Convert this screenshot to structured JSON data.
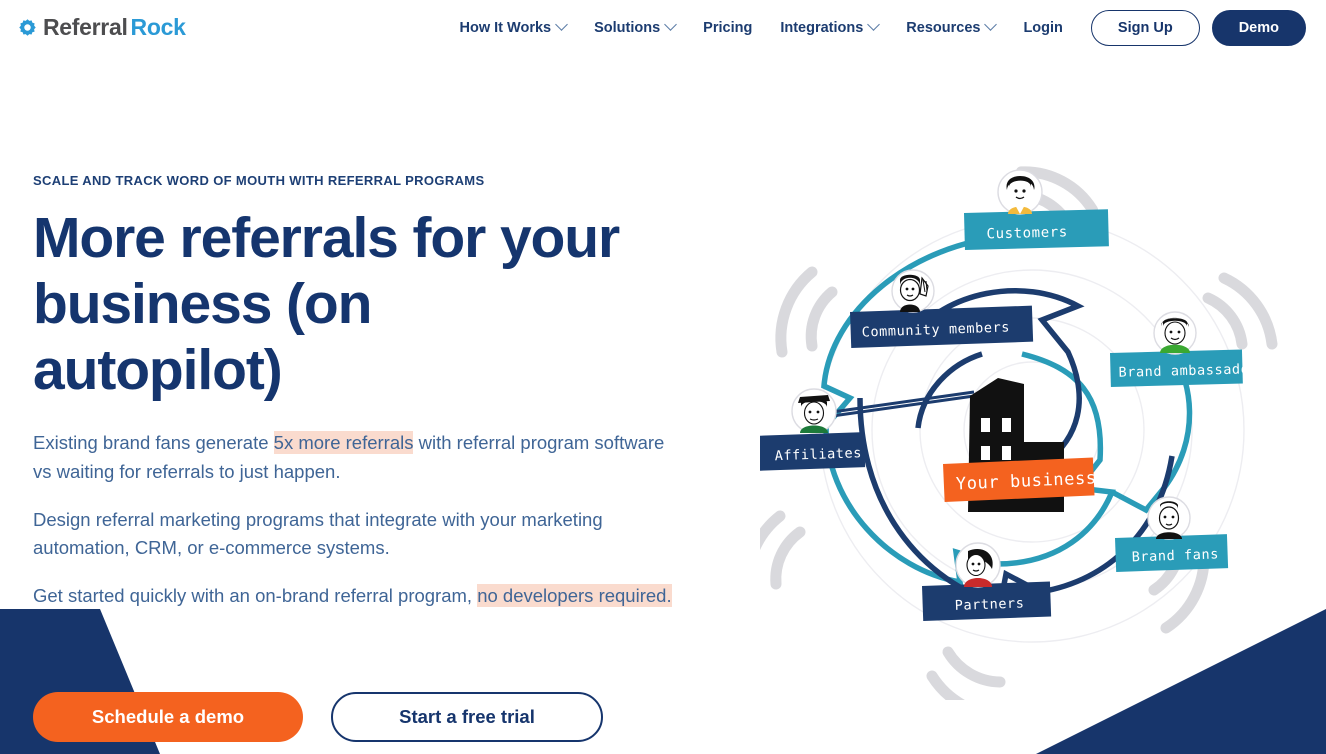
{
  "brand": {
    "icon": "gear-icon",
    "name_part1": "Referral",
    "name_part2": "Rock",
    "icon_color": "#2b9ad6"
  },
  "nav": {
    "items": [
      {
        "label": "How It Works",
        "has_dropdown": true
      },
      {
        "label": "Solutions",
        "has_dropdown": true
      },
      {
        "label": "Pricing",
        "has_dropdown": false
      },
      {
        "label": "Integrations",
        "has_dropdown": true
      },
      {
        "label": "Resources",
        "has_dropdown": true
      },
      {
        "label": "Login",
        "has_dropdown": false
      }
    ],
    "signup_label": "Sign Up",
    "demo_label": "Demo"
  },
  "hero": {
    "eyebrow": "SCALE AND TRACK WORD OF MOUTH WITH REFERRAL PROGRAMS",
    "headline": "More referrals for your business (on autopilot)",
    "paragraphs": [
      {
        "before": "Existing brand fans generate ",
        "highlight": "5x more referrals",
        "after": " with referral program software vs waiting for referrals to just happen."
      },
      {
        "before": "Design referral marketing programs that integrate with your marketing automation, CRM, or e-commerce systems.",
        "highlight": "",
        "after": ""
      },
      {
        "before": "Get started quickly with an on-brand referral program, ",
        "highlight": "no developers required.",
        "after": ""
      }
    ],
    "cta_primary": "Schedule a demo",
    "cta_secondary": "Start a free trial"
  },
  "illustration": {
    "center_label": "Your business",
    "center_icon": "office-building-icon",
    "nodes": [
      {
        "label": "Customers",
        "color": "#2a9cb8",
        "avatar": "customer-avatar"
      },
      {
        "label": "Community members",
        "color": "#1c3c6e",
        "avatar": "community-member-avatar"
      },
      {
        "label": "Brand ambassadors",
        "color": "#2a9cb8",
        "avatar": "brand-ambassador-avatar"
      },
      {
        "label": "Brand fans",
        "color": "#2a9cb8",
        "avatar": "brand-fan-avatar"
      },
      {
        "label": "Partners",
        "color": "#1c3c6e",
        "avatar": "partner-avatar"
      },
      {
        "label": "Affiliates",
        "color": "#1c3c6e",
        "avatar": "affiliate-avatar"
      }
    ]
  },
  "colors": {
    "navy": "#17356b",
    "orange": "#f4621f",
    "teal": "#2a9cb8",
    "blue": "#2b9ad6",
    "highlight": "#fadbce",
    "body_text": "#3f6596"
  }
}
